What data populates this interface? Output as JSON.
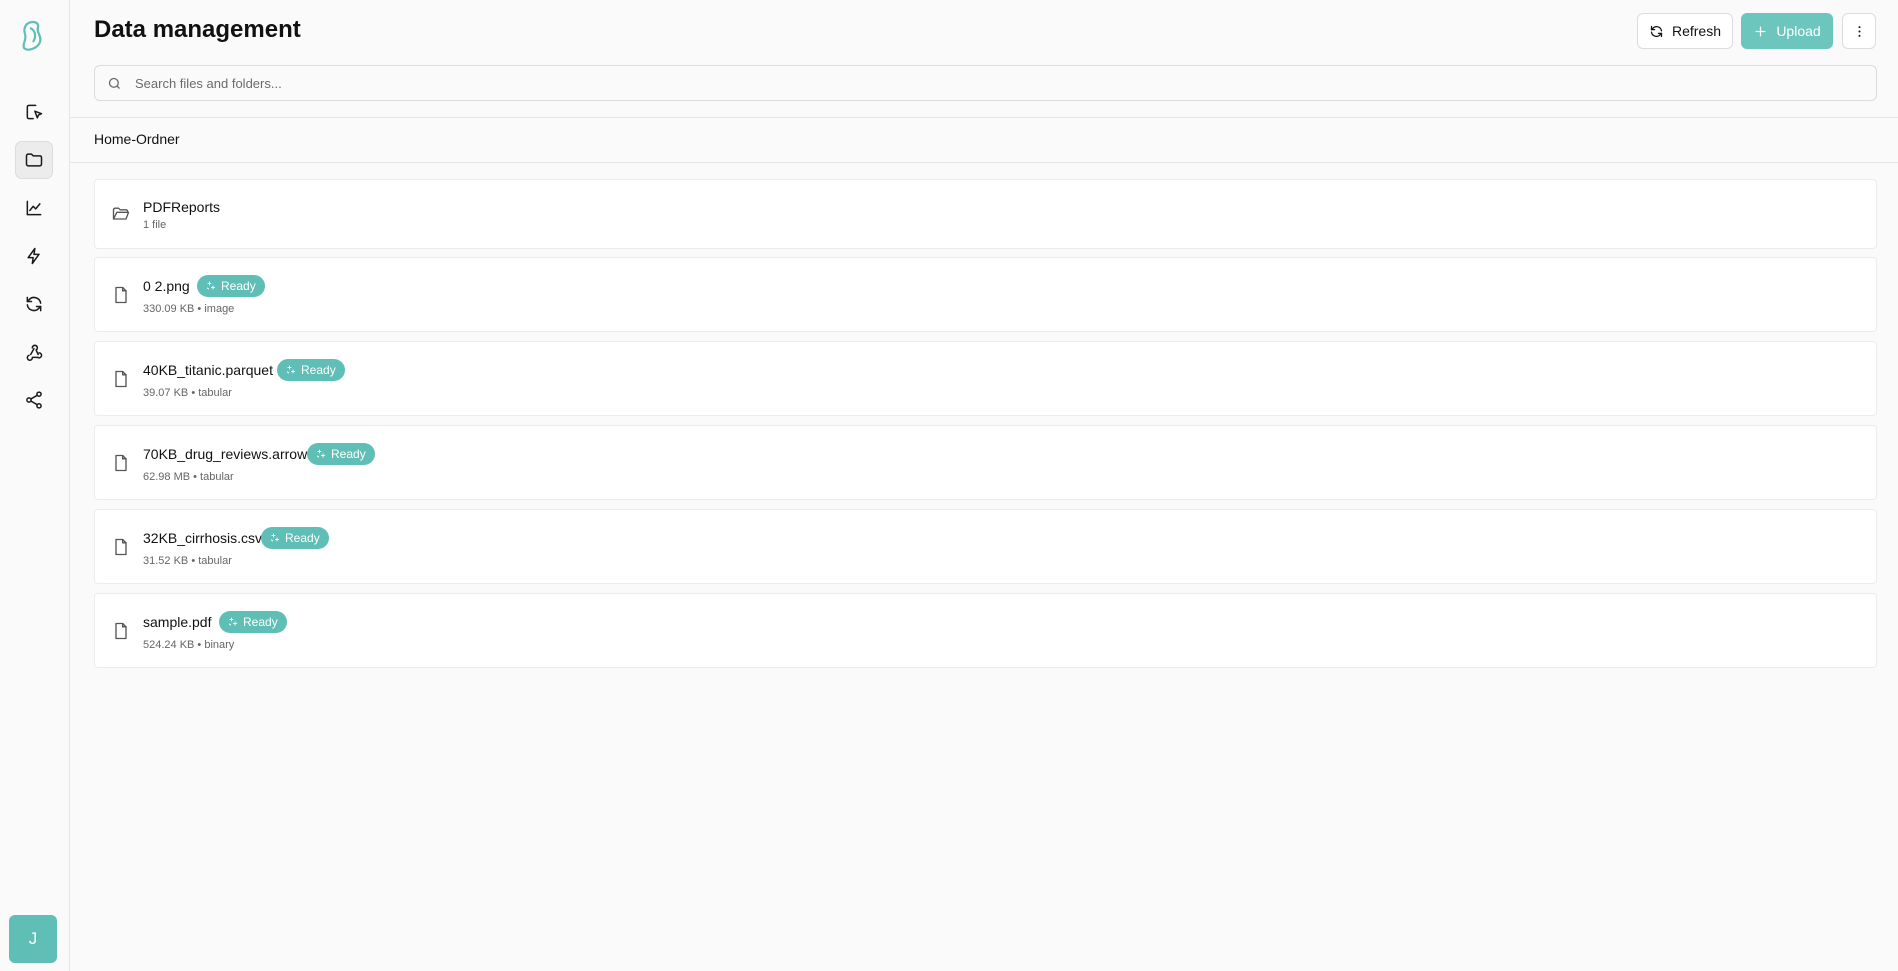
{
  "header": {
    "title": "Data management",
    "refresh_label": "Refresh",
    "upload_label": "Upload"
  },
  "search": {
    "placeholder": "Search files and folders..."
  },
  "breadcrumb": "Home-Ordner",
  "sidebar": {
    "avatar_initial": "J",
    "items": [
      {
        "icon": "pointer-select-icon"
      },
      {
        "icon": "folder-icon",
        "active": true
      },
      {
        "icon": "line-chart-icon"
      },
      {
        "icon": "lightning-icon"
      },
      {
        "icon": "refresh-icon"
      },
      {
        "icon": "webhook-icon"
      },
      {
        "icon": "share-icon"
      }
    ]
  },
  "files": {
    "folder": {
      "name": "PDFReports",
      "meta": "1 file"
    },
    "items": [
      {
        "name": "0 2.png",
        "status": "Ready",
        "meta": "330.09 KB • image"
      },
      {
        "name": "40KB_titanic.parquet",
        "status": "Ready",
        "meta": "39.07 KB • tabular"
      },
      {
        "name": "70KB_drug_reviews.arrow",
        "status": "Ready",
        "meta": "62.98 MB • tabular"
      },
      {
        "name": "32KB_cirrhosis.csv",
        "status": "Ready",
        "meta": "31.52 KB • tabular"
      },
      {
        "name": "sample.pdf",
        "status": "Ready",
        "meta": "524.24 KB • binary"
      }
    ]
  },
  "colors": {
    "accent": "#5fbfb6",
    "upload_button": "#6cc6bd",
    "background": "#fafafa"
  }
}
